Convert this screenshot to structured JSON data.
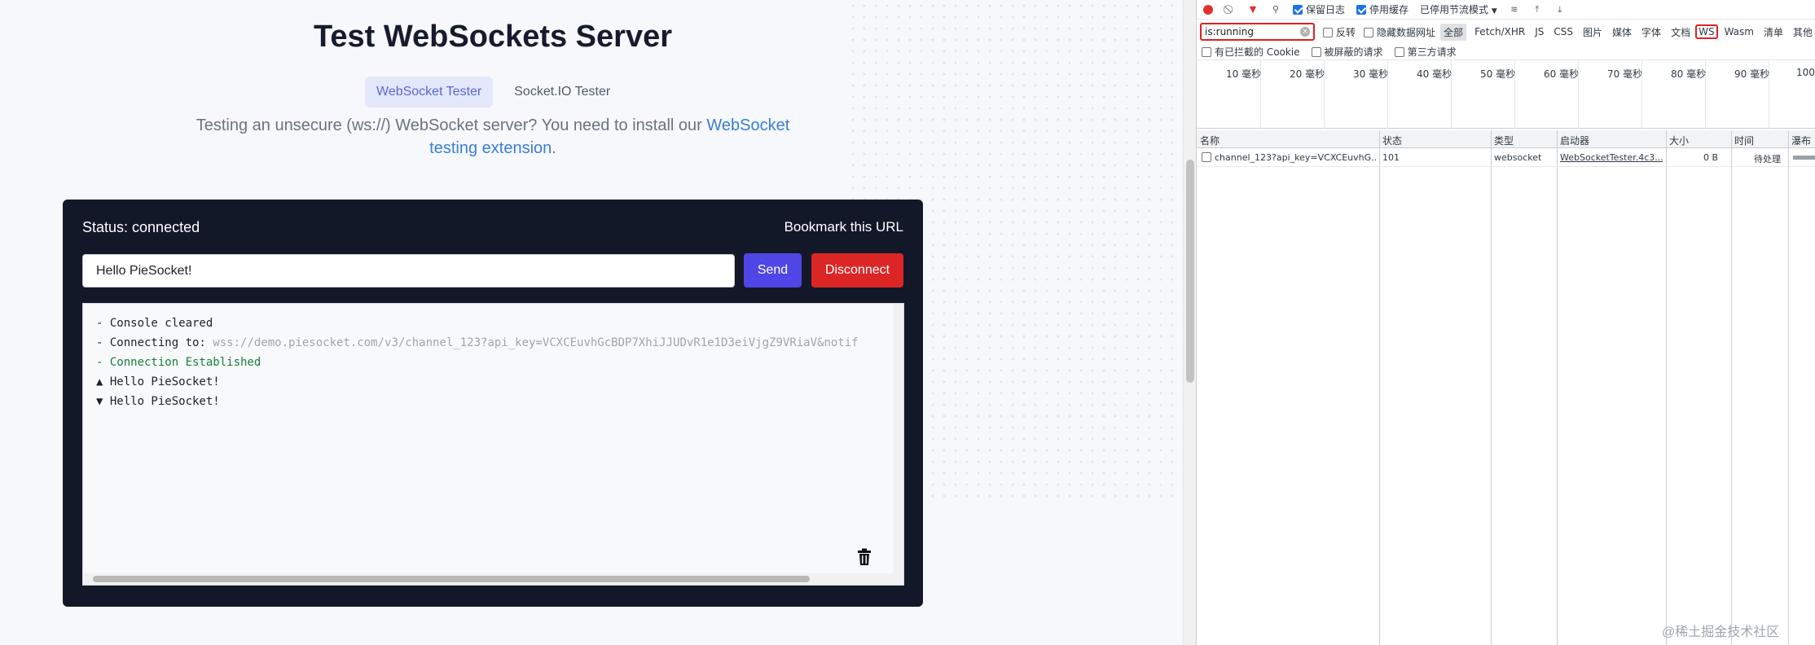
{
  "page": {
    "title": "Test WebSockets Server",
    "tabs": [
      {
        "label": "WebSocket Tester",
        "active": true
      },
      {
        "label": "Socket.IO Tester",
        "active": false
      }
    ],
    "intro": {
      "text_before": "Testing an unsecure (ws://) WebSocket server? You need to install our ",
      "link_text": "WebSocket testing extension",
      "text_after": "."
    },
    "panel": {
      "status": "Status: connected",
      "bookmark": "Bookmark this URL",
      "message_value": "Hello PieSocket!",
      "send_label": "Send",
      "disconnect_label": "Disconnect",
      "console": [
        {
          "prefix": "- ",
          "text": "Console cleared",
          "url": ""
        },
        {
          "prefix": "- ",
          "text": "Connecting to: ",
          "url": "wss://demo.piesocket.com/v3/channel_123?api_key=VCXCEuvhGcBDP7XhiJJUDvR1e1D3eiVjgZ9VRiaV&notif"
        },
        {
          "prefix": "- ",
          "text": "Connection Established",
          "url": ""
        },
        {
          "prefix": "▲ ",
          "text": "Hello PieSocket!",
          "url": ""
        },
        {
          "prefix": "▼ ",
          "text": "Hello PieSocket!",
          "url": ""
        }
      ]
    }
  },
  "devtools": {
    "toolbar": {
      "preserve_log": "保留日志",
      "disable_cache": "停用缓存",
      "throttling": "已停用节流模式"
    },
    "filter": {
      "value": "is:running",
      "invert": "反转",
      "hide_data_urls": "隐藏数据网址",
      "types": [
        "全部",
        "Fetch/XHR",
        "JS",
        "CSS",
        "图片",
        "媒体",
        "字体",
        "文档",
        "WS",
        "Wasm",
        "清单",
        "其他"
      ],
      "active_type": "全部",
      "highlighted_type": "WS"
    },
    "filter_row2": {
      "blocked_cookies": "有已拦截的 Cookie",
      "blocked_requests": "被屏蔽的请求",
      "third_party": "第三方请求"
    },
    "timeline_ticks": [
      "10 毫秒",
      "20 毫秒",
      "30 毫秒",
      "40 毫秒",
      "50 毫秒",
      "60 毫秒",
      "70 毫秒",
      "80 毫秒",
      "90 毫秒",
      "100"
    ],
    "columns": [
      "名称",
      "状态",
      "类型",
      "启动器",
      "大小",
      "时间",
      "瀑布"
    ],
    "rows": [
      {
        "name": "channel_123?api_key=VCXCEuvhG...",
        "status": "101",
        "type": "websocket",
        "initiator": "WebSocketTester.4c3...",
        "size": "0 B",
        "time": "待处理"
      }
    ]
  },
  "watermark": "@稀土掘金技术社区"
}
